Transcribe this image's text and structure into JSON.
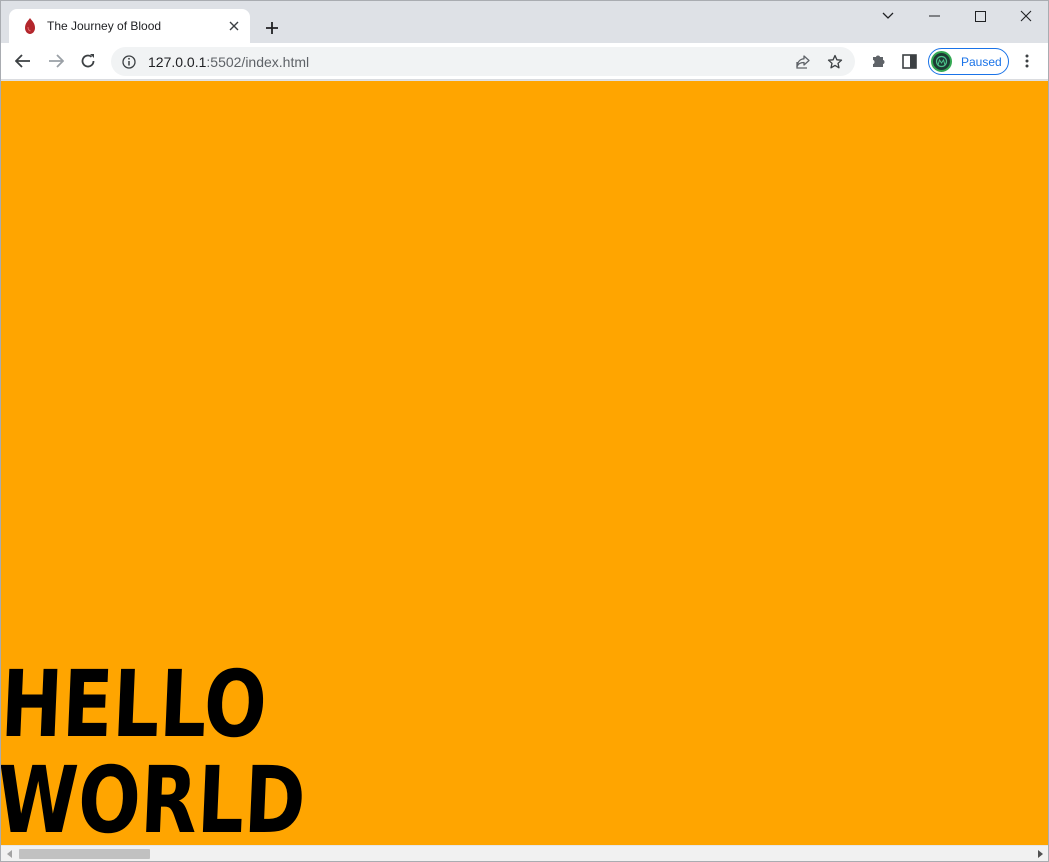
{
  "browser": {
    "tab": {
      "title": "The Journey of Blood",
      "favicon": "blood-drop-icon"
    },
    "address_bar": {
      "url_host": "127.0.0.1",
      "url_rest": ":5502/index.html"
    },
    "profile": {
      "label": "Paused"
    }
  },
  "page": {
    "heading_line1": "HELLO",
    "heading_line2": "WORLD",
    "background_color": "#ffa500"
  }
}
